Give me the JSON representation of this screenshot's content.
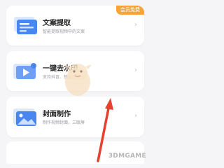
{
  "cards": [
    {
      "title": "文案提取",
      "subtitle": "智能提取视频中的文案",
      "badge": "会员免费",
      "icon": "text-extract-icon"
    },
    {
      "title": "一键去水印",
      "subtitle": "支持抖音、快手等平台",
      "icon": "video-watermark-icon"
    },
    {
      "title": "封面制作",
      "subtitle": "制作视频封面，三联屏",
      "icon": "image-cover-icon"
    }
  ],
  "chevron": "›",
  "watermark": "3DMGAME",
  "colors": {
    "badge": "#f6a53a",
    "arrow": "#e8402e",
    "icon_blue": "#4a86f0",
    "icon_light": "#dbe8fd"
  }
}
